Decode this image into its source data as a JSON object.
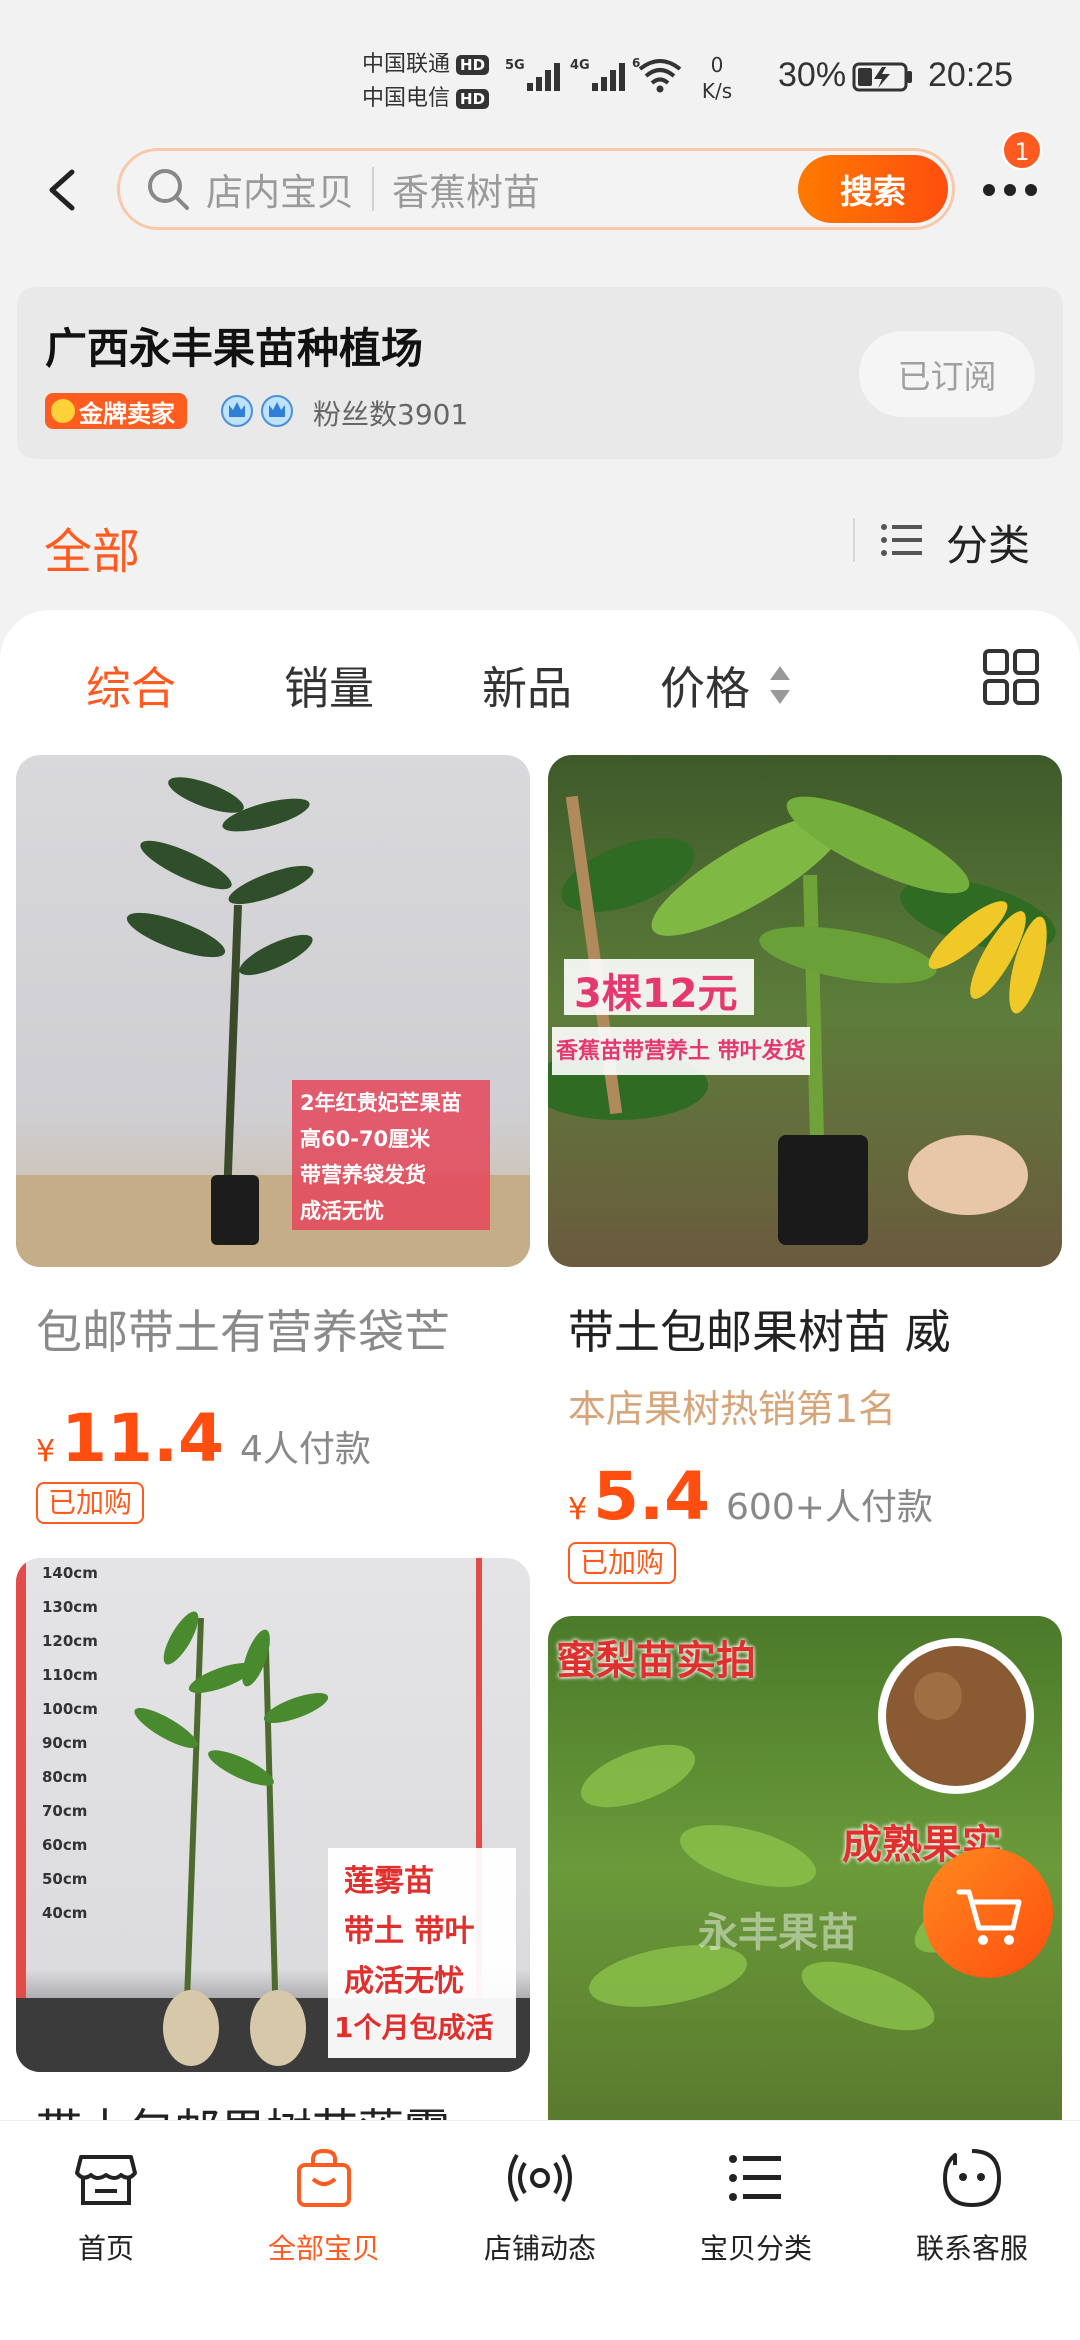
{
  "status_bar": {
    "carrier1": "中国联通",
    "carrier2": "中国电信",
    "hd": "HD",
    "net_speed_value": "0",
    "net_speed_unit": "K/s",
    "battery": "30%",
    "time": "20:25"
  },
  "search": {
    "scope": "店内宝贝",
    "hint": "香蕉树苗",
    "button": "搜索",
    "badge": "1"
  },
  "shop": {
    "name": "广西永丰果苗种植场",
    "badge": "金牌卖家",
    "fans": "粉丝数3901",
    "subscribe": "已订阅"
  },
  "filter": {
    "all": "全部",
    "category": "分类"
  },
  "sort": {
    "items": [
      "综合",
      "销量",
      "新品",
      "价格"
    ]
  },
  "products": [
    {
      "title": "包邮带土有营养袋芒",
      "price": "11.4",
      "paid": "4人付款",
      "tag": "已加购",
      "overlay": [
        "2年红贵妃芒果苗",
        "高60-70厘米",
        "带营养袋发货",
        "成活无忧"
      ]
    },
    {
      "title": "带土包邮果树苗 威",
      "promo": "本店果树热销第1名",
      "price": "5.4",
      "paid": "600+人付款",
      "tag": "已加购",
      "overlay": [
        "3棵12元",
        "香蕉苗带营养土 带叶发货"
      ]
    },
    {
      "title": "带土包邮果树苗莲雾",
      "overlay": [
        "莲雾苗",
        "带土 带叶",
        "成活无忧",
        "1个月包成活"
      ],
      "scale": [
        "140cm",
        "130cm",
        "120cm",
        "110cm",
        "100cm",
        "90cm",
        "80cm",
        "70cm",
        "60cm",
        "50cm",
        "40cm"
      ]
    },
    {
      "overlay": [
        "蜜梨苗实拍",
        "成熟果实",
        "永丰果苗"
      ]
    }
  ],
  "price_symbol": "¥",
  "nav": {
    "items": [
      "首页",
      "全部宝贝",
      "店铺动态",
      "宝贝分类",
      "联系客服"
    ]
  },
  "colors": {
    "accent": "#ff5a1f",
    "promo": "#d7a57a"
  }
}
